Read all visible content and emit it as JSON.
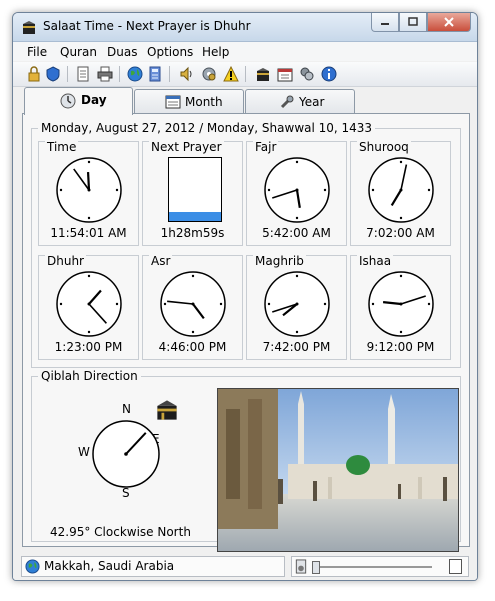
{
  "window": {
    "title": "Salaat Time - Next Prayer is Dhuhr"
  },
  "menu": [
    "File",
    "Quran",
    "Duas",
    "Options",
    "Help"
  ],
  "toolbar": {
    "icons": [
      "lock-icon",
      "shield-icon",
      "document-icon",
      "printer-icon",
      "globe-icon",
      "calculator-icon",
      "speaker-icon",
      "settings-icon",
      "warning-icon",
      "kaaba-icon",
      "calendar-icon",
      "tools-icon",
      "info-icon"
    ]
  },
  "tabs": [
    {
      "label": "Day",
      "icon": "clock-icon",
      "active": true
    },
    {
      "label": "Month",
      "icon": "calendar-icon",
      "active": false
    },
    {
      "label": "Year",
      "icon": "wrench-icon",
      "active": false
    }
  ],
  "date_header": "Monday, August 27, 2012 / Monday, Shawwal 10, 1433",
  "clocks": [
    {
      "label": "Time",
      "time": "11:54:01 AM",
      "h": 11,
      "m": 54,
      "s": 1
    },
    {
      "label": "Next Prayer",
      "time": "1h28m59s",
      "progress": 0.15
    },
    {
      "label": "Fajr",
      "time": "5:42:00 AM",
      "h": 5,
      "m": 42,
      "s": 0
    },
    {
      "label": "Shurooq",
      "time": "7:02:00 AM",
      "h": 7,
      "m": 2,
      "s": 0
    },
    {
      "label": "Dhuhr",
      "time": "1:23:00 PM",
      "h": 1,
      "m": 23,
      "s": 0
    },
    {
      "label": "Asr",
      "time": "4:46:00 PM",
      "h": 4,
      "m": 46,
      "s": 0
    },
    {
      "label": "Maghrib",
      "time": "7:42:00 PM",
      "h": 7,
      "m": 42,
      "s": 0
    },
    {
      "label": "Ishaa",
      "time": "9:12:00 PM",
      "h": 9,
      "m": 12,
      "s": 0
    }
  ],
  "qiblah": {
    "title": "Qiblah Direction",
    "n": "N",
    "e": "E",
    "s": "S",
    "w": "W",
    "degrees": 42.95,
    "caption": "42.95° Clockwise North"
  },
  "status": {
    "location": "Makkah, Saudi Arabia"
  },
  "colors": {
    "accent": "#3b8ee6",
    "panel": "#f7f7f7"
  }
}
